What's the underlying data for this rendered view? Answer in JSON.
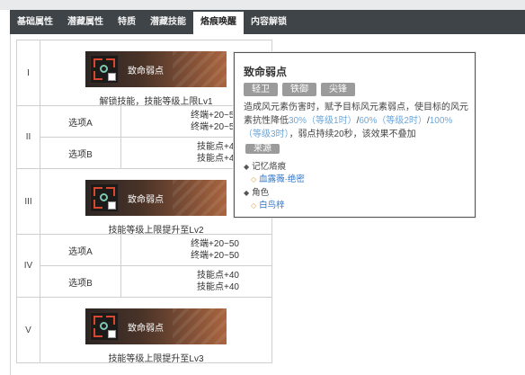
{
  "tabs": [
    "基础属性",
    "潜藏属性",
    "特质",
    "潜藏技能",
    "烙痕唤醒",
    "内容解锁"
  ],
  "active_tab": "烙痕唤醒",
  "table": {
    "levels": [
      {
        "level": "I",
        "kind": "skill",
        "skill_name": "致命弱点",
        "caption": "解锁技能，技能等级上限Lv1"
      },
      {
        "level": "II",
        "kind": "options",
        "options": [
          {
            "label": "选项A",
            "bonus": [
              "终端+20~50",
              "终端+20~50"
            ]
          },
          {
            "label": "选项B",
            "bonus": [
              "技能点+40",
              "技能点+40"
            ]
          }
        ]
      },
      {
        "level": "III",
        "kind": "skill",
        "skill_name": "致命弱点",
        "caption": "技能等级上限提升至Lv2"
      },
      {
        "level": "IV",
        "kind": "options",
        "options": [
          {
            "label": "选项A",
            "bonus": [
              "终端+20~50",
              "终端+20~50"
            ]
          },
          {
            "label": "选项B",
            "bonus": [
              "技能点+40",
              "技能点+40"
            ]
          }
        ]
      },
      {
        "level": "V",
        "kind": "skill",
        "skill_name": "致命弱点",
        "caption": "技能等级上限提升至Lv3"
      }
    ]
  },
  "tooltip": {
    "title": "致命弱点",
    "tags": [
      "轻卫",
      "铁御",
      "尖锋"
    ],
    "desc_1": "造成风元素伤害时，赋予目标风元素弱点，使目标的风元素抗性降低",
    "pct_1": "30%（等级1时）",
    "pct_2": "60%（等级2时）",
    "pct_3": "100%（等级3时）",
    "desc_2": "，弱点持续20秒，该效果不叠加",
    "source_tag": "来源",
    "section_memory": "记忆烙痕",
    "memory_link": "血露薇·绝密",
    "section_role": "角色",
    "role_link": "白鸟梓"
  }
}
